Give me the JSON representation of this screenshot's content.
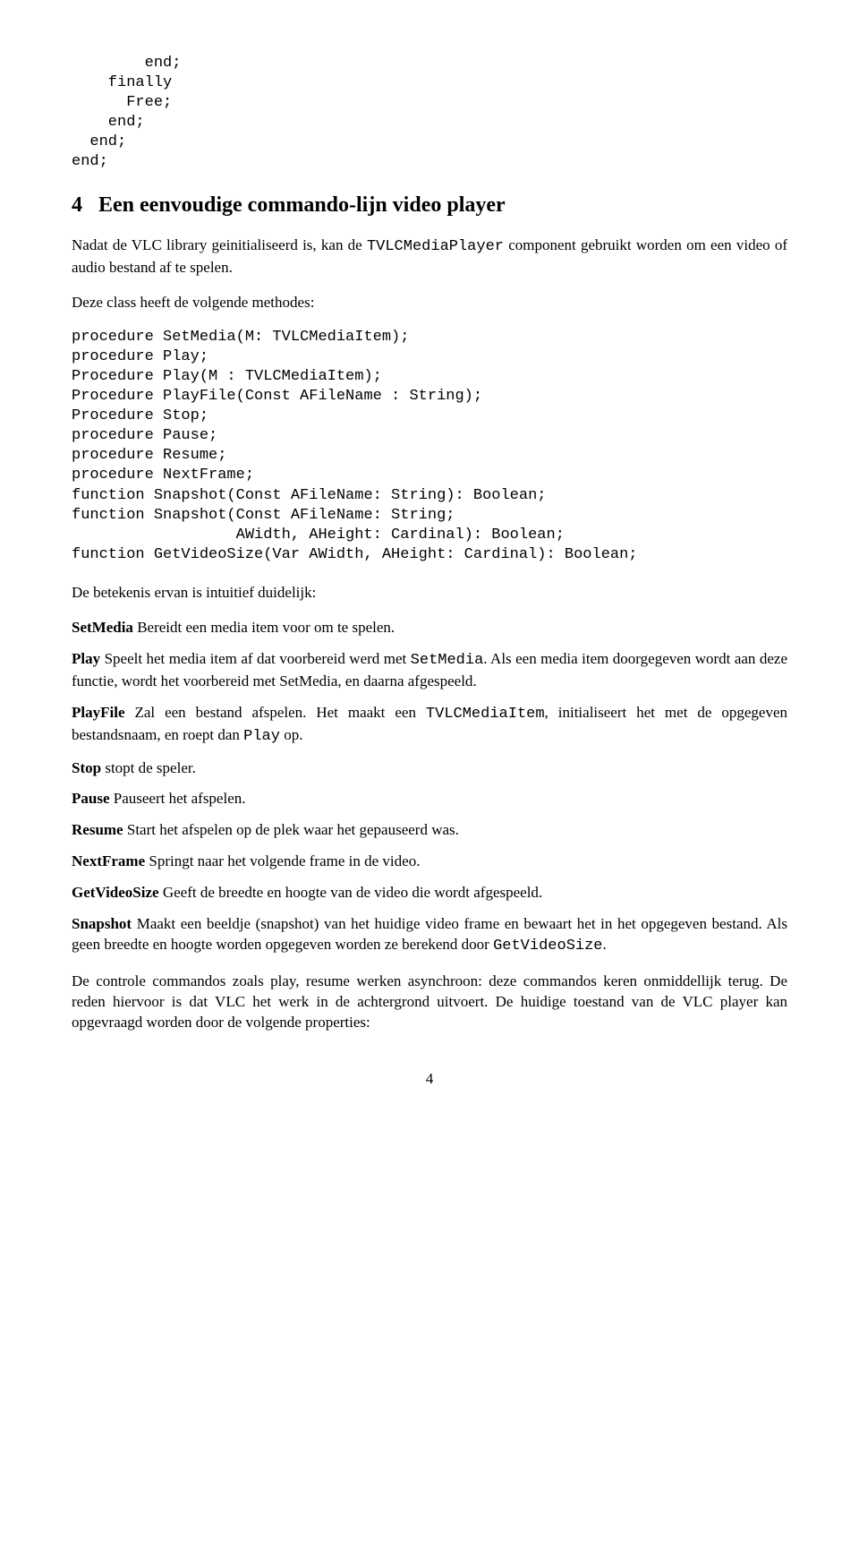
{
  "code_top": "        end;\n    finally\n      Free;\n    end;\n  end;\nend;",
  "section": {
    "num": "4",
    "title": "Een eenvoudige commando-lijn video player"
  },
  "intro": {
    "a": "Nadat de VLC library geinitialiseerd is, kan de ",
    "tt1": "TVLCMediaPlayer",
    "b": " component gebruikt worden om een video of audio bestand af te spelen.",
    "c": "Deze class heeft de volgende methodes:"
  },
  "code_methods": "procedure SetMedia(M: TVLCMediaItem);\nprocedure Play;\nProcedure Play(M : TVLCMediaItem);\nProcedure PlayFile(Const AFileName : String);\nProcedure Stop;\nprocedure Pause;\nprocedure Resume;\nprocedure NextFrame;\nfunction Snapshot(Const AFileName: String): Boolean;\nfunction Snapshot(Const AFileName: String;\n                  AWidth, AHeight: Cardinal): Boolean;\nfunction GetVideoSize(Var AWidth, AHeight: Cardinal): Boolean;",
  "meaning_intro": "De betekenis ervan is intuitief duidelijk:",
  "defs": {
    "setmedia": {
      "term": "SetMedia",
      "desc": "Bereidt een media item voor om te spelen."
    },
    "play": {
      "term": "Play",
      "a": "Speelt het media item af dat voorbereid werd met ",
      "tt": "SetMedia",
      "b": ". Als een media item doorgegeven wordt aan deze functie, wordt het voorbereid met SetMedia, en daarna afgespeeld."
    },
    "playfile": {
      "term": "PlayFile",
      "a": "Zal een bestand afspelen. Het maakt een ",
      "tt1": "TVLCMediaItem",
      "b": ", initialiseert het met de opgegeven bestandsnaam, en roept dan ",
      "tt2": "Play",
      "c": " op."
    },
    "stop": {
      "term": "Stop",
      "desc": "stopt de speler."
    },
    "pause": {
      "term": "Pause",
      "desc": "Pauseert het afspelen."
    },
    "resume": {
      "term": "Resume",
      "desc": "Start het afspelen op de plek waar het gepauseerd was."
    },
    "nextframe": {
      "term": "NextFrame",
      "desc": "Springt naar het volgende frame in de video."
    },
    "getvideosize": {
      "term": "GetVideoSize",
      "desc": "Geeft de breedte en hoogte van de video die wordt afgespeeld."
    },
    "snapshot": {
      "term": "Snapshot",
      "a": "Maakt een beeldje (snapshot) van het huidige video frame en bewaart het in het opgegeven bestand. Als geen breedte en hoogte worden opgegeven worden ze berekend door ",
      "tt": "GetVideoSize",
      "b": "."
    }
  },
  "closing": "De controle commandos zoals play, resume werken asynchroon: deze commandos keren onmiddellijk terug. De reden hiervoor is dat VLC het werk in de achtergrond uitvoert. De huidige toestand van de VLC player kan opgevraagd worden door de volgende properties:",
  "pagenum": "4"
}
